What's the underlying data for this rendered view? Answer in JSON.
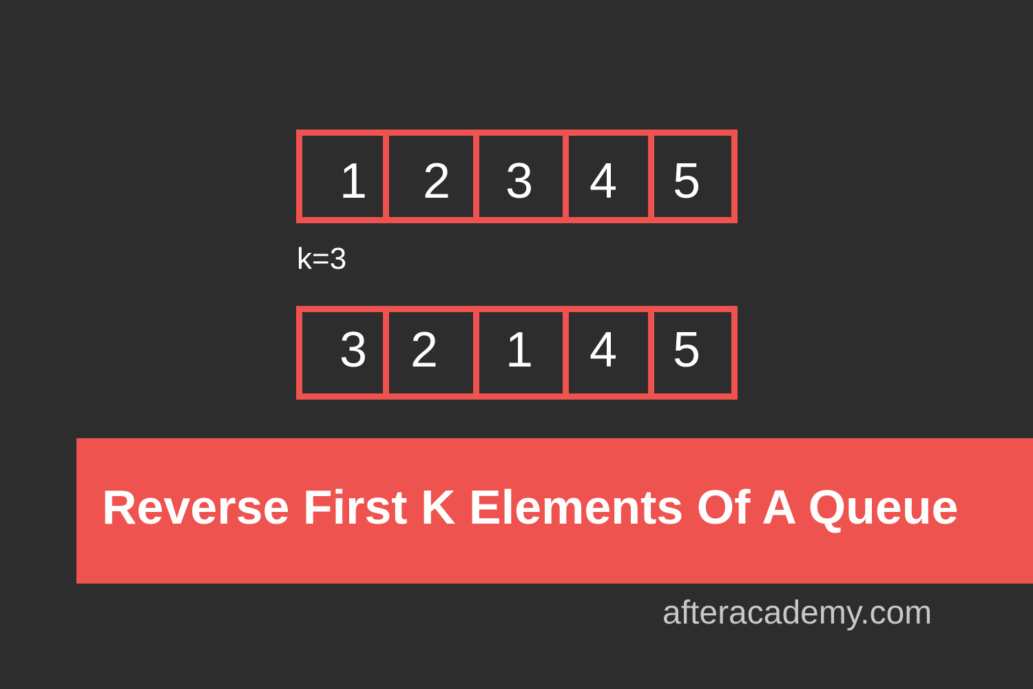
{
  "colors": {
    "background": "#2d2d2d",
    "accent": "#ef5350",
    "text": "#ffffff",
    "muted_text": "#c8c8c8"
  },
  "queues": [
    {
      "items": [
        "1",
        "2",
        "3",
        "4",
        "5"
      ]
    },
    {
      "items": [
        "3",
        "2",
        "1",
        "4",
        "5"
      ]
    }
  ],
  "k_label": "k=3",
  "title": "Reverse First K Elements Of A Queue",
  "site": "afteracademy.com"
}
